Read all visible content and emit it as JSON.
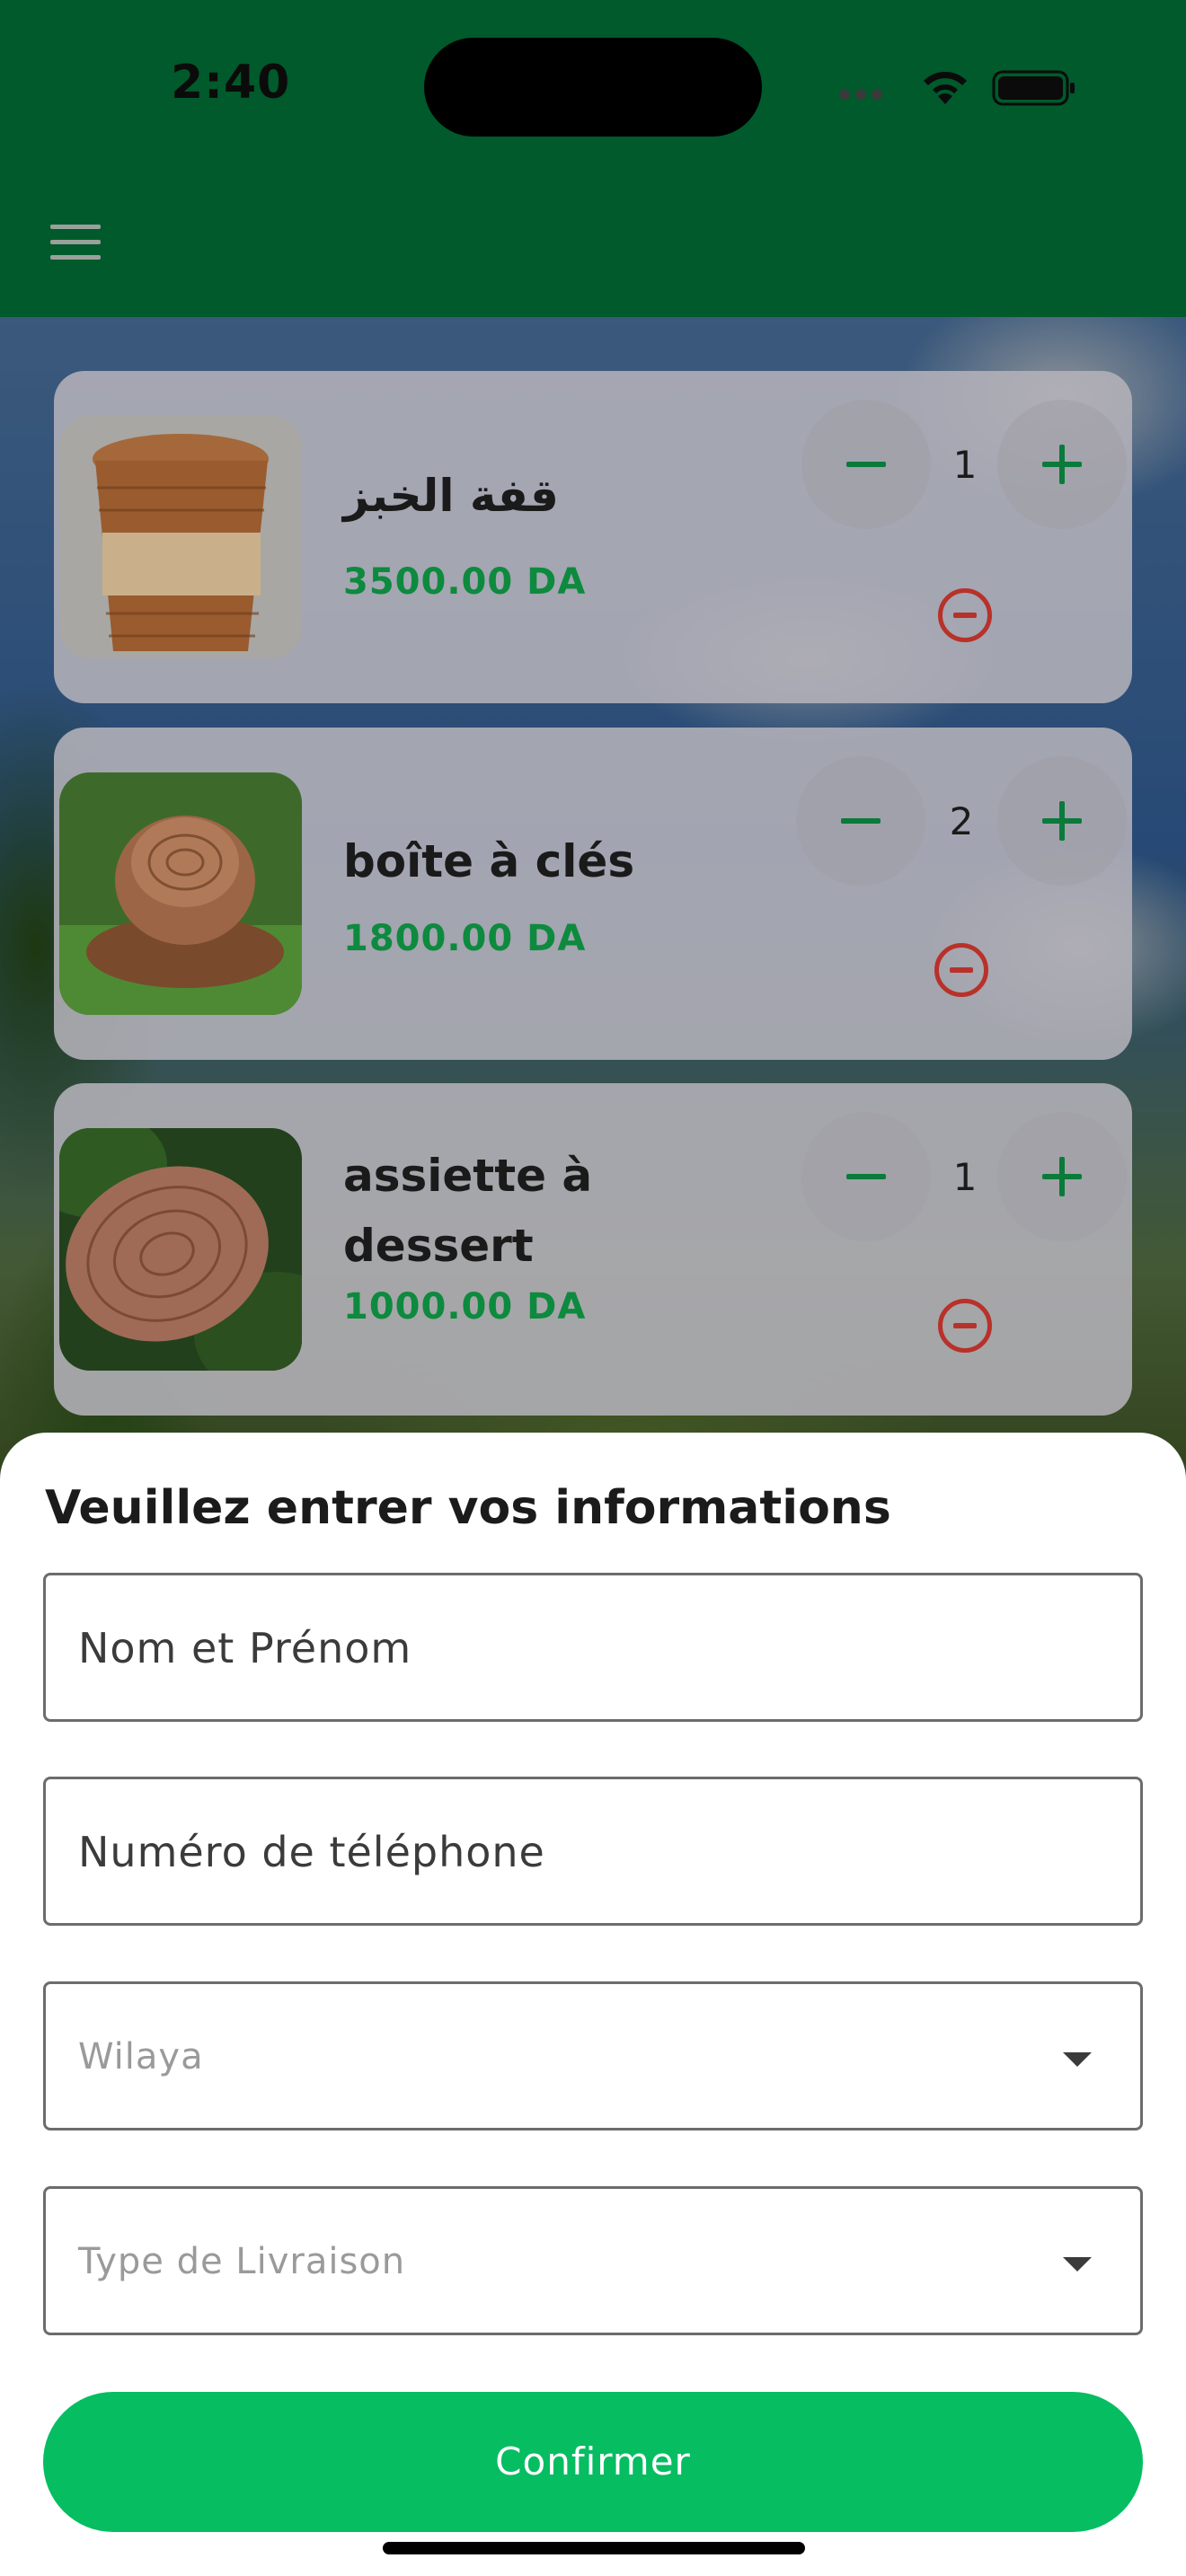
{
  "status_bar": {
    "time": "2:40"
  },
  "header": {
    "menu_icon": "hamburger-menu-icon",
    "background": "#005a2b"
  },
  "cart": {
    "items": [
      {
        "title": "قفة الخبز",
        "price": "3500.00 DA",
        "quantity": "1"
      },
      {
        "title": "boîte à clés",
        "price": "1800.00 DA",
        "quantity": "2"
      },
      {
        "title": "assiette à dessert",
        "price": "1000.00 DA",
        "quantity": "1"
      }
    ],
    "icons": {
      "decrease": "minus-icon",
      "increase": "plus-icon",
      "remove": "remove-circle-icon"
    }
  },
  "form": {
    "title": "Veuillez entrer vos informations",
    "name_label": "Nom et Prénom",
    "phone_label": "Numéro de téléphone",
    "wilaya_placeholder": "Wilaya",
    "delivery_placeholder": "Type de Livraison",
    "confirm_label": "Confirmer"
  },
  "colors": {
    "primary_green": "#06bd62",
    "price_green": "#0d8a3e",
    "remove_red": "#b8312a"
  }
}
